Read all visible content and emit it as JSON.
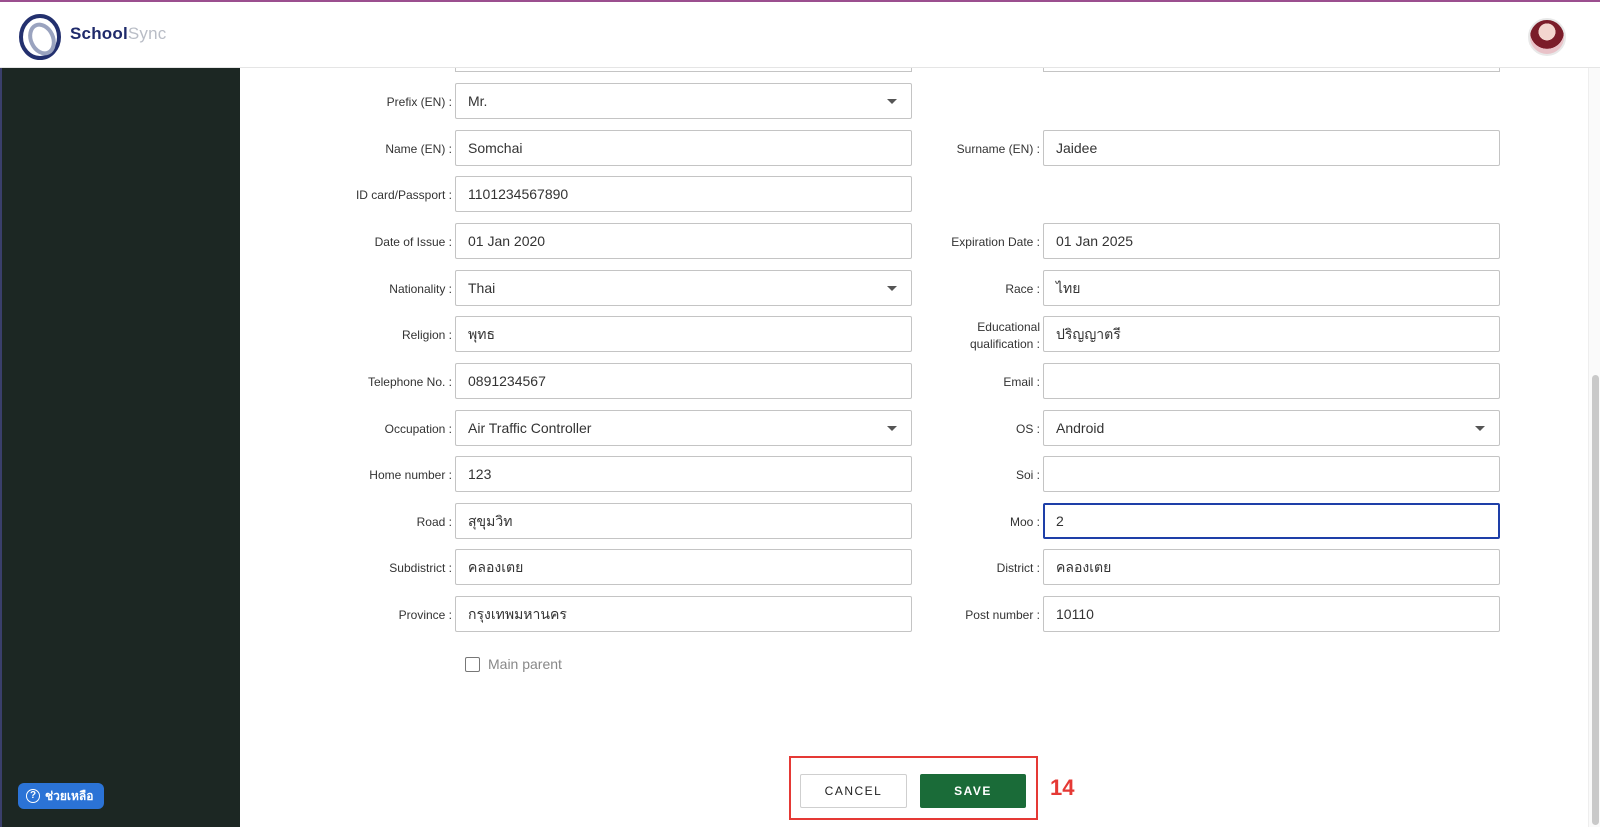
{
  "app": {
    "brand_bold": "School",
    "brand_light": "Sync"
  },
  "help": {
    "label": "ช่วยเหลือ",
    "icon": "question-circle-icon"
  },
  "form": {
    "prefix_en": {
      "label": "Prefix (EN) :",
      "value": "Mr."
    },
    "name_en": {
      "label": "Name (EN) :",
      "value": "Somchai"
    },
    "surname_en": {
      "label": "Surname (EN) :",
      "value": "Jaidee"
    },
    "id_card": {
      "label": "ID card/Passport :",
      "value": "1101234567890"
    },
    "date_of_issue": {
      "label": "Date of Issue :",
      "value": "01 Jan 2020"
    },
    "expiration_date": {
      "label": "Expiration Date :",
      "value": "01 Jan 2025"
    },
    "nationality": {
      "label": "Nationality :",
      "value": "Thai"
    },
    "race": {
      "label": "Race :",
      "value": "ไทย"
    },
    "religion": {
      "label": "Religion :",
      "value": "พุทธ"
    },
    "education": {
      "label_line1": "Educational",
      "label_line2": "qualification :",
      "value": "ปริญญาตรี"
    },
    "telephone": {
      "label": "Telephone No. :",
      "value": "0891234567"
    },
    "email": {
      "label": "Email :",
      "value": ""
    },
    "occupation": {
      "label": "Occupation :",
      "value": "Air Traffic Controller"
    },
    "os": {
      "label": "OS :",
      "value": "Android"
    },
    "home_number": {
      "label": "Home number :",
      "value": "123"
    },
    "soi": {
      "label": "Soi :",
      "value": ""
    },
    "road": {
      "label": "Road :",
      "value": "สุขุมวิท"
    },
    "moo": {
      "label": "Moo :",
      "value": "2"
    },
    "subdistrict": {
      "label": "Subdistrict :",
      "value": "คลองเตย"
    },
    "district": {
      "label": "District :",
      "value": "คลองเตย"
    },
    "province": {
      "label": "Province :",
      "value": "กรุงเทพมหานคร"
    },
    "post_number": {
      "label": "Post number :",
      "value": "10110"
    },
    "main_parent": {
      "label": "Main parent",
      "checked": false
    }
  },
  "actions": {
    "cancel_label": "CANCEL",
    "save_label": "SAVE"
  },
  "annotation": {
    "step": "14",
    "color": "#e53935"
  },
  "colors": {
    "sidebar": "#1c2723",
    "save": "#1a6b38",
    "focus": "#1e3fa8",
    "help": "#2b73d6"
  }
}
